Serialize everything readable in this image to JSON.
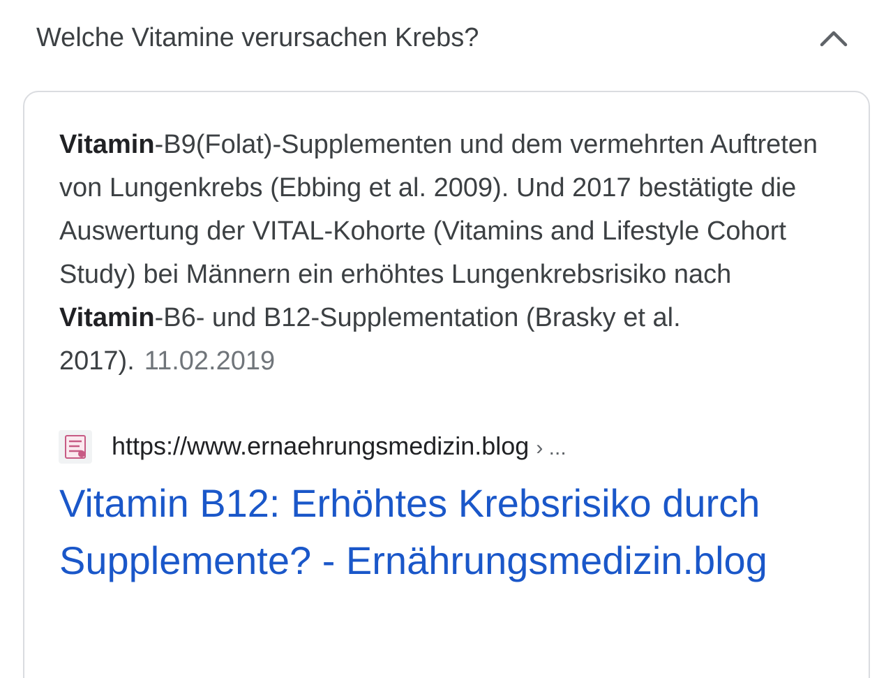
{
  "question": {
    "text": "Welche Vitamine verursachen Krebs?",
    "expanded_icon": "chevron-up-icon"
  },
  "snippet": {
    "parts": [
      {
        "text": "Vitamin",
        "bold": true
      },
      {
        "text": "-B9(Folat)-Supplementen und dem vermehrten Auftreten von Lungenkrebs (Ebbing et al. 2009). Und 2017 bestätigte die Auswertung der VITAL-Kohorte (Vitamins and Lifestyle Cohort Study) bei Männern ein erhöhtes Lungenkrebsrisiko nach ",
        "bold": false
      },
      {
        "text": "Vitamin",
        "bold": true
      },
      {
        "text": "-B6- und B12-Supplementation (Brasky et al. 2017).",
        "bold": false
      }
    ],
    "date": "11.02.2019"
  },
  "source": {
    "favicon": "ernaehrungsmedizin-favicon",
    "url": "https://www.ernaehrungsmedizin.blog",
    "breadcrumb": "› ..."
  },
  "result": {
    "title": "Vitamin B12: Erhöhtes Krebsrisiko durch Supplemente? - Ernährungsmedizin.blog"
  },
  "colors": {
    "link": "#1a57c9",
    "text": "#3c4043",
    "muted": "#70757a",
    "border": "#dadce0"
  }
}
